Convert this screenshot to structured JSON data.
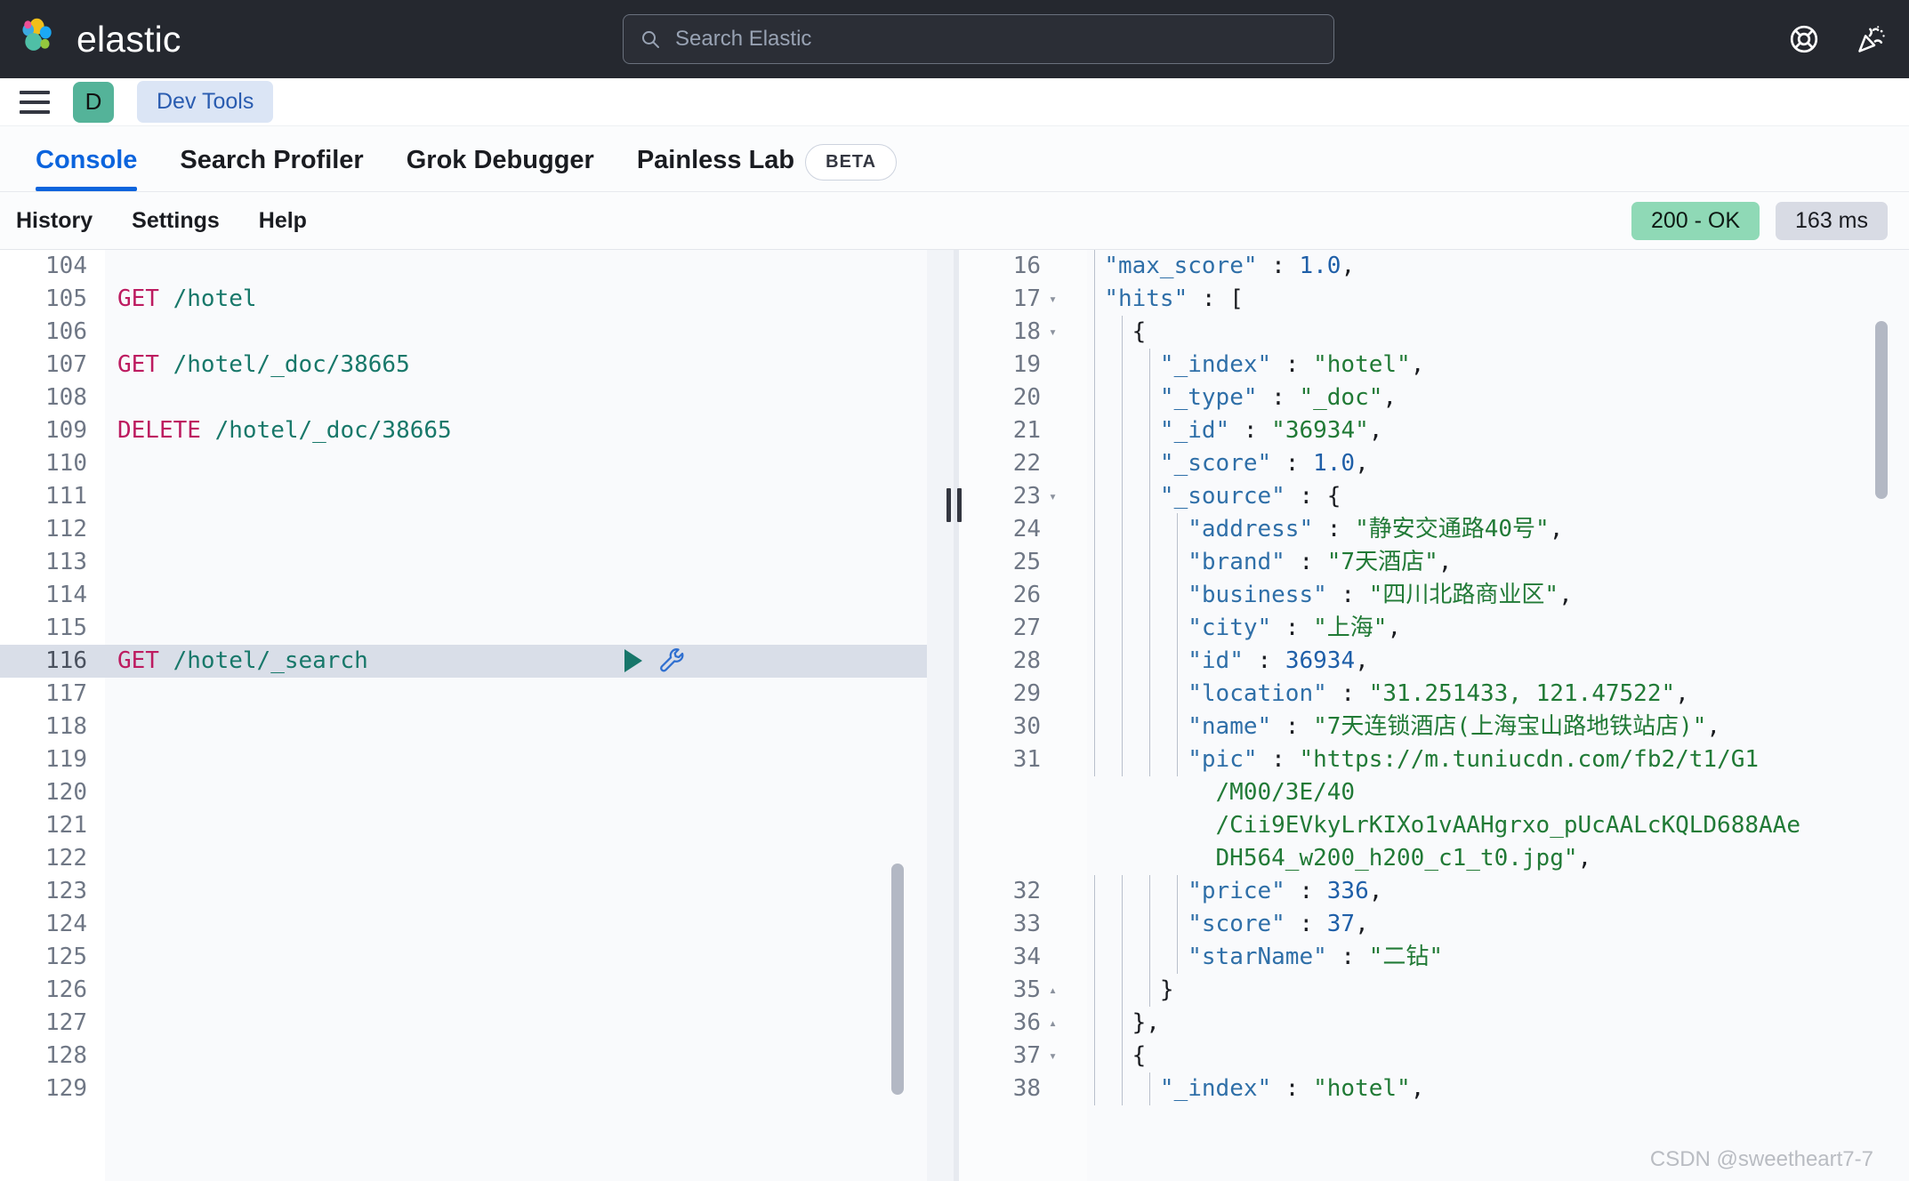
{
  "header": {
    "brand": "elastic",
    "search": {
      "placeholder": "Search Elastic",
      "icon": "search-icon"
    },
    "icons": [
      {
        "name": "help-lifebuoy-icon"
      },
      {
        "name": "announcements-party-icon"
      }
    ]
  },
  "breadcrumb": {
    "menu_icon": "hamburger-menu-icon",
    "space_initial": "D",
    "crumb": "Dev Tools"
  },
  "tabs": [
    {
      "label": "Console",
      "active": true
    },
    {
      "label": "Search Profiler",
      "active": false
    },
    {
      "label": "Grok Debugger",
      "active": false
    },
    {
      "label": "Painless Lab",
      "active": false
    }
  ],
  "beta_badge": "BETA",
  "toolbar": {
    "history": "History",
    "settings": "Settings",
    "help": "Help",
    "status_code": "200 - OK",
    "status_color": "#8fd9b6",
    "duration": "163 ms"
  },
  "editor": {
    "active_line": 116,
    "run_icon": "play-triangle-icon",
    "wrench_icon": "wrench-icon",
    "lines": [
      {
        "no": "104",
        "segments": []
      },
      {
        "no": "105",
        "segments": [
          {
            "t": "GET ",
            "c": "kw-method"
          },
          {
            "t": "/hotel",
            "c": "kw-path"
          }
        ]
      },
      {
        "no": "106",
        "segments": []
      },
      {
        "no": "107",
        "segments": [
          {
            "t": "GET ",
            "c": "kw-method"
          },
          {
            "t": "/hotel/_doc/38665",
            "c": "kw-path"
          }
        ]
      },
      {
        "no": "108",
        "segments": []
      },
      {
        "no": "109",
        "segments": [
          {
            "t": "DELETE ",
            "c": "kw-method"
          },
          {
            "t": "/hotel/_doc/38665",
            "c": "kw-path"
          }
        ]
      },
      {
        "no": "110",
        "segments": []
      },
      {
        "no": "111",
        "segments": []
      },
      {
        "no": "112",
        "segments": []
      },
      {
        "no": "113",
        "segments": []
      },
      {
        "no": "114",
        "segments": []
      },
      {
        "no": "115",
        "segments": []
      },
      {
        "no": "116",
        "active": true,
        "segments": [
          {
            "t": "GET ",
            "c": "kw-method"
          },
          {
            "t": "/hotel/_search",
            "c": "kw-path"
          }
        ]
      },
      {
        "no": "117",
        "segments": []
      },
      {
        "no": "118",
        "segments": []
      },
      {
        "no": "119",
        "segments": []
      },
      {
        "no": "120",
        "segments": []
      },
      {
        "no": "121",
        "segments": []
      },
      {
        "no": "122",
        "segments": []
      },
      {
        "no": "123",
        "segments": []
      },
      {
        "no": "124",
        "segments": []
      },
      {
        "no": "125",
        "segments": []
      },
      {
        "no": "126",
        "segments": []
      },
      {
        "no": "127",
        "segments": []
      },
      {
        "no": "128",
        "segments": []
      },
      {
        "no": "129",
        "segments": []
      }
    ]
  },
  "response": {
    "lines": [
      {
        "no": "16",
        "fold": "",
        "guides": 1,
        "segments": [
          {
            "t": "  ",
            "c": "j-punct"
          },
          {
            "t": "\"max_score\"",
            "c": "j-key"
          },
          {
            "t": " : ",
            "c": "j-punct"
          },
          {
            "t": "1.0",
            "c": "j-num"
          },
          {
            "t": ",",
            "c": "j-punct"
          }
        ]
      },
      {
        "no": "17",
        "fold": "▾",
        "guides": 1,
        "segments": [
          {
            "t": "  ",
            "c": "j-punct"
          },
          {
            "t": "\"hits\"",
            "c": "j-key"
          },
          {
            "t": " : [",
            "c": "j-punct"
          }
        ]
      },
      {
        "no": "18",
        "fold": "▾",
        "guides": 2,
        "segments": [
          {
            "t": "    {",
            "c": "j-punct"
          }
        ]
      },
      {
        "no": "19",
        "fold": "",
        "guides": 3,
        "segments": [
          {
            "t": "      ",
            "c": "j-punct"
          },
          {
            "t": "\"_index\"",
            "c": "j-key"
          },
          {
            "t": " : ",
            "c": "j-punct"
          },
          {
            "t": "\"hotel\"",
            "c": "j-str"
          },
          {
            "t": ",",
            "c": "j-punct"
          }
        ]
      },
      {
        "no": "20",
        "fold": "",
        "guides": 3,
        "segments": [
          {
            "t": "      ",
            "c": "j-punct"
          },
          {
            "t": "\"_type\"",
            "c": "j-key"
          },
          {
            "t": " : ",
            "c": "j-punct"
          },
          {
            "t": "\"_doc\"",
            "c": "j-str"
          },
          {
            "t": ",",
            "c": "j-punct"
          }
        ]
      },
      {
        "no": "21",
        "fold": "",
        "guides": 3,
        "segments": [
          {
            "t": "      ",
            "c": "j-punct"
          },
          {
            "t": "\"_id\"",
            "c": "j-key"
          },
          {
            "t": " : ",
            "c": "j-punct"
          },
          {
            "t": "\"36934\"",
            "c": "j-str"
          },
          {
            "t": ",",
            "c": "j-punct"
          }
        ]
      },
      {
        "no": "22",
        "fold": "",
        "guides": 3,
        "segments": [
          {
            "t": "      ",
            "c": "j-punct"
          },
          {
            "t": "\"_score\"",
            "c": "j-key"
          },
          {
            "t": " : ",
            "c": "j-punct"
          },
          {
            "t": "1.0",
            "c": "j-num"
          },
          {
            "t": ",",
            "c": "j-punct"
          }
        ]
      },
      {
        "no": "23",
        "fold": "▾",
        "guides": 3,
        "segments": [
          {
            "t": "      ",
            "c": "j-punct"
          },
          {
            "t": "\"_source\"",
            "c": "j-key"
          },
          {
            "t": " : {",
            "c": "j-punct"
          }
        ]
      },
      {
        "no": "24",
        "fold": "",
        "guides": 4,
        "segments": [
          {
            "t": "        ",
            "c": "j-punct"
          },
          {
            "t": "\"address\"",
            "c": "j-key"
          },
          {
            "t": " : ",
            "c": "j-punct"
          },
          {
            "t": "\"静安交通路40号\"",
            "c": "j-str"
          },
          {
            "t": ",",
            "c": "j-punct"
          }
        ]
      },
      {
        "no": "25",
        "fold": "",
        "guides": 4,
        "segments": [
          {
            "t": "        ",
            "c": "j-punct"
          },
          {
            "t": "\"brand\"",
            "c": "j-key"
          },
          {
            "t": " : ",
            "c": "j-punct"
          },
          {
            "t": "\"7天酒店\"",
            "c": "j-str"
          },
          {
            "t": ",",
            "c": "j-punct"
          }
        ]
      },
      {
        "no": "26",
        "fold": "",
        "guides": 4,
        "segments": [
          {
            "t": "        ",
            "c": "j-punct"
          },
          {
            "t": "\"business\"",
            "c": "j-key"
          },
          {
            "t": " : ",
            "c": "j-punct"
          },
          {
            "t": "\"四川北路商业区\"",
            "c": "j-str"
          },
          {
            "t": ",",
            "c": "j-punct"
          }
        ]
      },
      {
        "no": "27",
        "fold": "",
        "guides": 4,
        "segments": [
          {
            "t": "        ",
            "c": "j-punct"
          },
          {
            "t": "\"city\"",
            "c": "j-key"
          },
          {
            "t": " : ",
            "c": "j-punct"
          },
          {
            "t": "\"上海\"",
            "c": "j-str"
          },
          {
            "t": ",",
            "c": "j-punct"
          }
        ]
      },
      {
        "no": "28",
        "fold": "",
        "guides": 4,
        "segments": [
          {
            "t": "        ",
            "c": "j-punct"
          },
          {
            "t": "\"id\"",
            "c": "j-key"
          },
          {
            "t": " : ",
            "c": "j-punct"
          },
          {
            "t": "36934",
            "c": "j-num"
          },
          {
            "t": ",",
            "c": "j-punct"
          }
        ]
      },
      {
        "no": "29",
        "fold": "",
        "guides": 4,
        "segments": [
          {
            "t": "        ",
            "c": "j-punct"
          },
          {
            "t": "\"location\"",
            "c": "j-key"
          },
          {
            "t": " : ",
            "c": "j-punct"
          },
          {
            "t": "\"31.251433, 121.47522\"",
            "c": "j-str"
          },
          {
            "t": ",",
            "c": "j-punct"
          }
        ]
      },
      {
        "no": "30",
        "fold": "",
        "guides": 4,
        "segments": [
          {
            "t": "        ",
            "c": "j-punct"
          },
          {
            "t": "\"name\"",
            "c": "j-key"
          },
          {
            "t": " : ",
            "c": "j-punct"
          },
          {
            "t": "\"7天连锁酒店(上海宝山路地铁站店)\"",
            "c": "j-str"
          },
          {
            "t": ",",
            "c": "j-punct"
          }
        ]
      },
      {
        "no": "31",
        "fold": "",
        "guides": 4,
        "wrapped": true,
        "segments": [
          {
            "t": "        ",
            "c": "j-punct"
          },
          {
            "t": "\"pic\"",
            "c": "j-key"
          },
          {
            "t": " : ",
            "c": "j-punct"
          },
          {
            "t": "\"https://m.tuniucdn.com/fb2/t1/G1\n          /M00/3E/40\n          /Cii9EVkyLrKIXo1vAAHgrxo_pUcAALcKQLD688AAe\n          DH564_w200_h200_c1_t0.jpg\"",
            "c": "j-str"
          },
          {
            "t": ",",
            "c": "j-punct"
          }
        ]
      },
      {
        "no": "32",
        "fold": "",
        "guides": 4,
        "segments": [
          {
            "t": "        ",
            "c": "j-punct"
          },
          {
            "t": "\"price\"",
            "c": "j-key"
          },
          {
            "t": " : ",
            "c": "j-punct"
          },
          {
            "t": "336",
            "c": "j-num"
          },
          {
            "t": ",",
            "c": "j-punct"
          }
        ]
      },
      {
        "no": "33",
        "fold": "",
        "guides": 4,
        "segments": [
          {
            "t": "        ",
            "c": "j-punct"
          },
          {
            "t": "\"score\"",
            "c": "j-key"
          },
          {
            "t": " : ",
            "c": "j-punct"
          },
          {
            "t": "37",
            "c": "j-num"
          },
          {
            "t": ",",
            "c": "j-punct"
          }
        ]
      },
      {
        "no": "34",
        "fold": "",
        "guides": 4,
        "segments": [
          {
            "t": "        ",
            "c": "j-punct"
          },
          {
            "t": "\"starName\"",
            "c": "j-key"
          },
          {
            "t": " : ",
            "c": "j-punct"
          },
          {
            "t": "\"二钻\"",
            "c": "j-str"
          }
        ]
      },
      {
        "no": "35",
        "fold": "▴",
        "guides": 3,
        "segments": [
          {
            "t": "      }",
            "c": "j-punct"
          }
        ]
      },
      {
        "no": "36",
        "fold": "▴",
        "guides": 2,
        "segments": [
          {
            "t": "    },",
            "c": "j-punct"
          }
        ]
      },
      {
        "no": "37",
        "fold": "▾",
        "guides": 2,
        "segments": [
          {
            "t": "    {",
            "c": "j-punct"
          }
        ]
      },
      {
        "no": "38",
        "fold": "",
        "guides": 3,
        "segments": [
          {
            "t": "      ",
            "c": "j-punct"
          },
          {
            "t": "\"_index\"",
            "c": "j-key"
          },
          {
            "t": " : ",
            "c": "j-punct"
          },
          {
            "t": "\"hotel\"",
            "c": "j-str"
          },
          {
            "t": ",",
            "c": "j-punct"
          }
        ]
      }
    ]
  },
  "watermark": "CSDN @sweetheart7-7"
}
